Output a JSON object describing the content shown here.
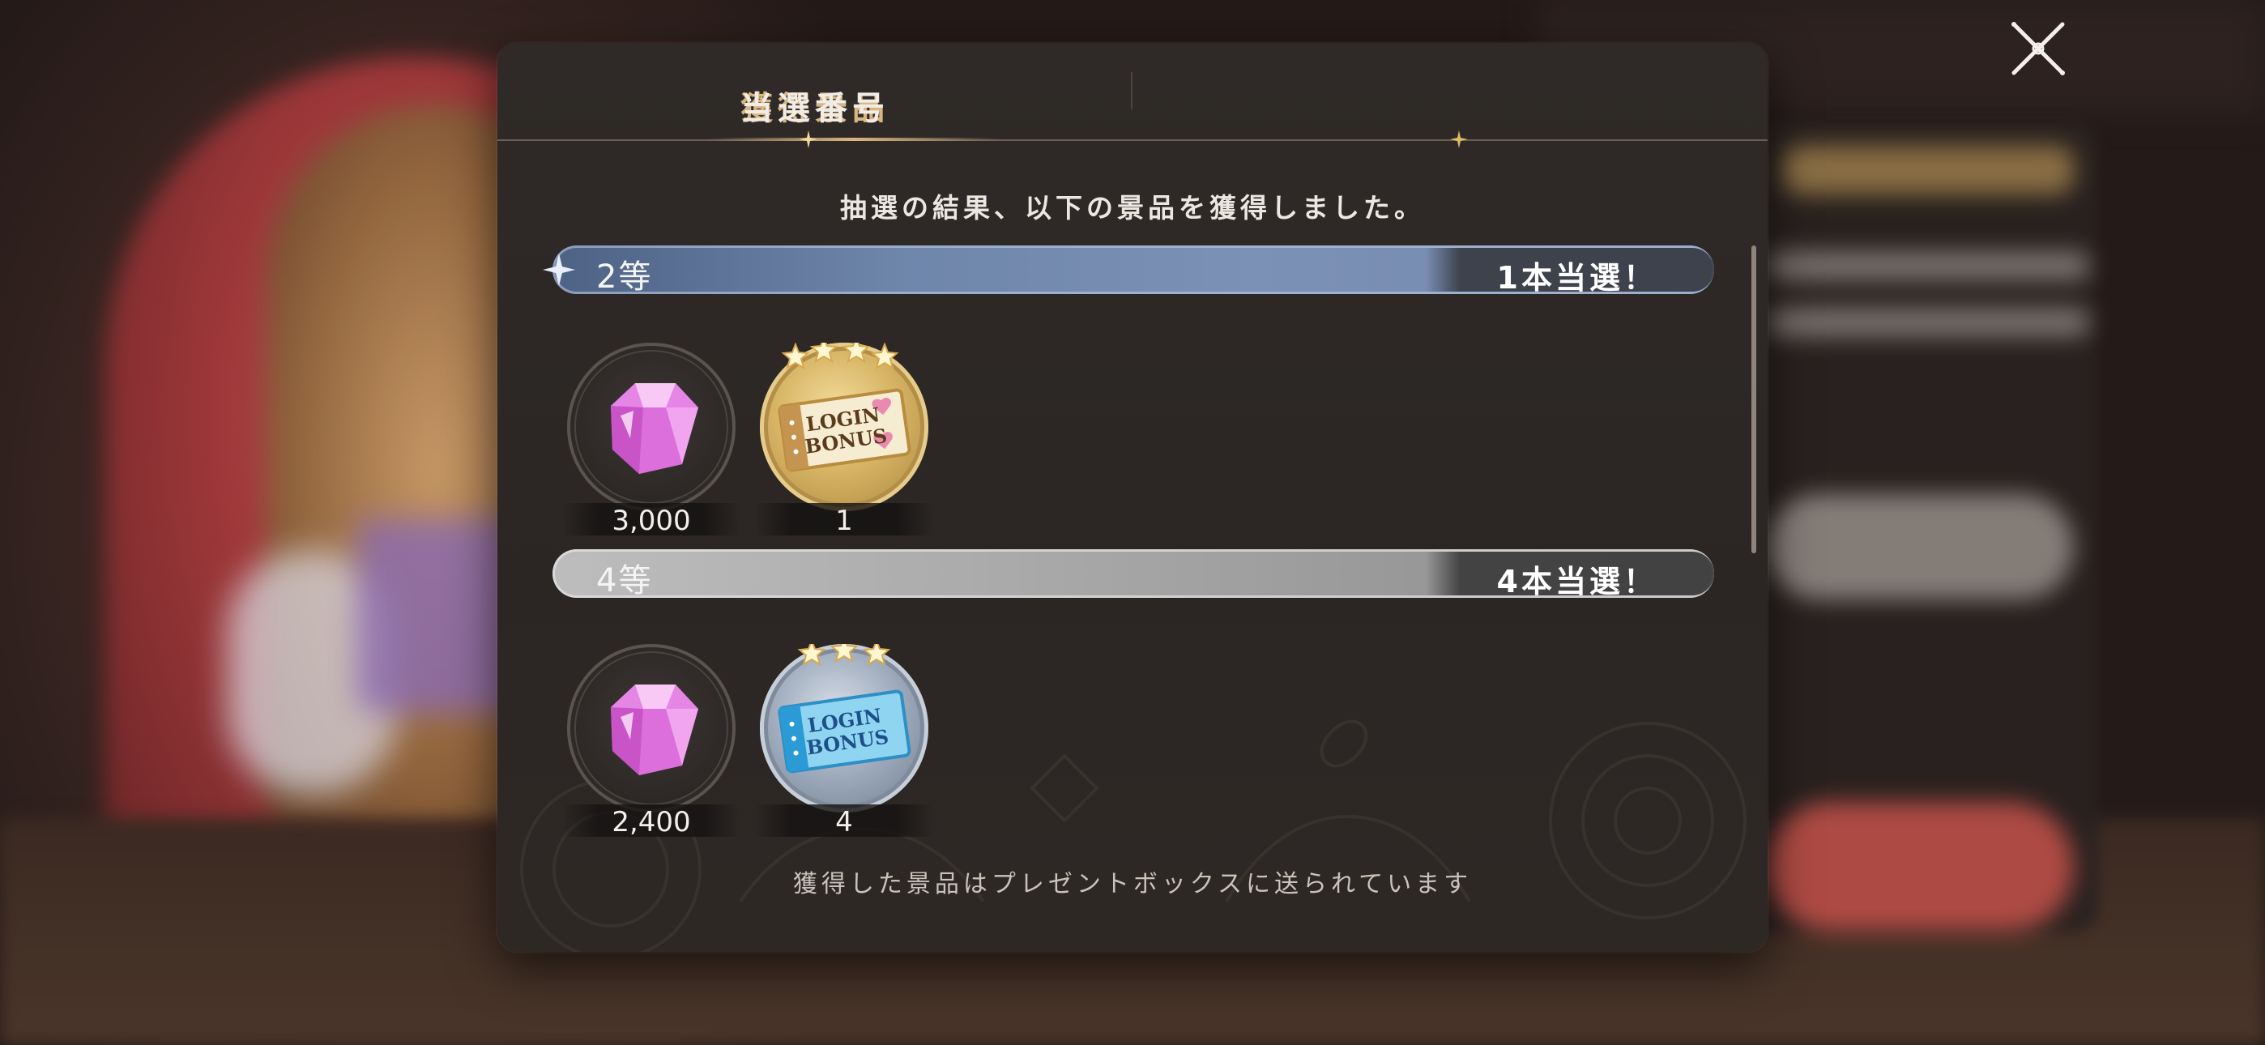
{
  "close_icon": "close-x-icon",
  "tabs": [
    {
      "label": "獲得景品",
      "active": true
    },
    {
      "label": "当選番号",
      "active": false
    }
  ],
  "intro_text": "抽選の結果、以下の景品を獲得しました。",
  "ranks": [
    {
      "label": "2等",
      "count_text": "1本当選！",
      "color": "#6f86ab",
      "items": [
        {
          "icon": "pink-gem-icon",
          "quantity": "3,000"
        },
        {
          "icon": "gold-login-bonus-ticket-icon",
          "quantity": "1",
          "stars": 4
        }
      ]
    },
    {
      "label": "4等",
      "count_text": "4本当選！",
      "color": "#a7a7a7",
      "items": [
        {
          "icon": "pink-gem-icon",
          "quantity": "2,400"
        },
        {
          "icon": "blue-login-bonus-ticket-icon",
          "quantity": "4",
          "stars": 3
        }
      ]
    }
  ],
  "ticket_text": [
    "LOGIN",
    "BONUS"
  ],
  "footer_note": "獲得した景品はプレゼントボックスに送られています",
  "colors": {
    "tab_active": "#d9b680",
    "panel": "#2d2825",
    "accent_gold": "#d9b680"
  }
}
